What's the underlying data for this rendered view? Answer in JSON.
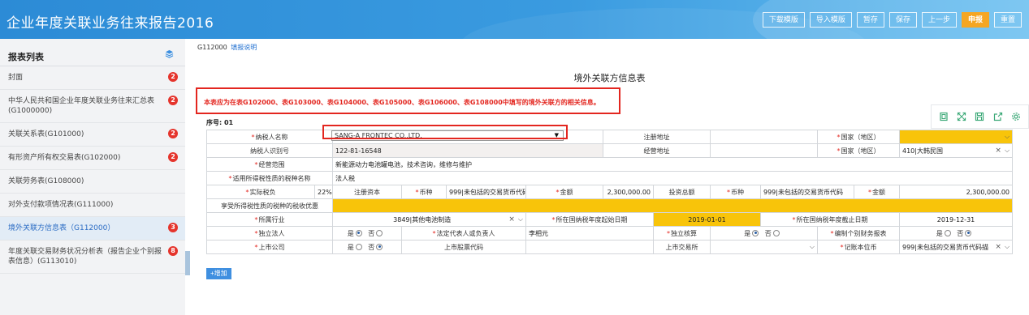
{
  "app": {
    "title": "企业年度关联业务往来报告2016"
  },
  "toolbar": {
    "buttons": [
      "下载模版",
      "导入模版",
      "暂存",
      "保存",
      "上一步",
      "申报",
      "重置"
    ]
  },
  "sidebar": {
    "title": "报表列表",
    "items": [
      {
        "label": "封面",
        "badge": "2"
      },
      {
        "label": "中华人民共和国企业年度关联业务往来汇总表(G1000000)",
        "badge": "2"
      },
      {
        "label": "关联关系表(G101000)",
        "badge": "2"
      },
      {
        "label": "有形资产所有权交易表(G102000)",
        "badge": "2"
      },
      {
        "label": "关联劳务表(G108000)",
        "badge": ""
      },
      {
        "label": "对外支付款项情况表(G111000)",
        "badge": ""
      },
      {
        "label": "境外关联方信息表（G112000）",
        "badge": "3",
        "active": true
      },
      {
        "label": "年度关联交易财务状况分析表（报告企业个别报表信息）(G113010)",
        "badge": "8"
      }
    ]
  },
  "main": {
    "form_code": "G112000",
    "help_link": "填报说明",
    "form_title": "境外关联方信息表",
    "notice": "本表应为在表G102000、表G103000、表G104000、表G105000、表G106000、表G108000中填写的境外关联方的相关信息。",
    "seq_label": "序号: 01",
    "add_button": "+增加"
  },
  "form": {
    "taxpayer_name_label": "纳税人名称",
    "taxpayer_name_value": "SANG-A FRONTEC CO.,LTD.",
    "reg_address_label": "注册地址",
    "country_label": "国家（地区）",
    "taxpayer_id_label": "纳税人识别号",
    "taxpayer_id_value": "122-81-16548",
    "biz_address_label": "经营地址",
    "country2_label": "国家（地区）",
    "country2_value": "410|大韩民国",
    "scope_label": "经营范围",
    "scope_value": "新能源动力电池罐电池，技术咨询，维修与维护",
    "tax_type_label": "适用所得税性质的税种名称",
    "tax_type_value": "法人税",
    "actual_tax_label": "实际税负",
    "actual_tax_value": "22%",
    "reg_capital_label": "注册资本",
    "currency_label": "币种",
    "currency_value": "999|未包括的交易货币代码",
    "amount_label": "金额",
    "amount_value": "2,300,000.00",
    "invest_label": "投资总额",
    "currency2_label": "币种",
    "currency2_value": "999|未包括的交易货币代码",
    "amount2_label": "金额",
    "amount2_value": "2,300,000.00",
    "preferential_label": "享受所得税性质的税种的税收优惠",
    "industry_label": "所属行业",
    "industry_value": "3849|其他电池制造",
    "fy_start_label": "所在国纳税年度起始日期",
    "fy_start_value": "2019-01-01",
    "fy_end_label": "所在国纳税年度截止日期",
    "fy_end_value": "2019-12-31",
    "independent_label": "独立法人",
    "yes": "是",
    "no": "否",
    "legal_rep_label": "法定代表人或负责人",
    "legal_rep_value": "李相元",
    "indep_acct_label": "独立核算",
    "separate_fs_label": "编制个别财务报表",
    "listed_label": "上市公司",
    "stock_code_label": "上市股票代码",
    "exchange_label": "上市交易所",
    "reporting_currency_label": "记账本位币",
    "reporting_currency_value": "999|未包括的交易货币代码描"
  }
}
